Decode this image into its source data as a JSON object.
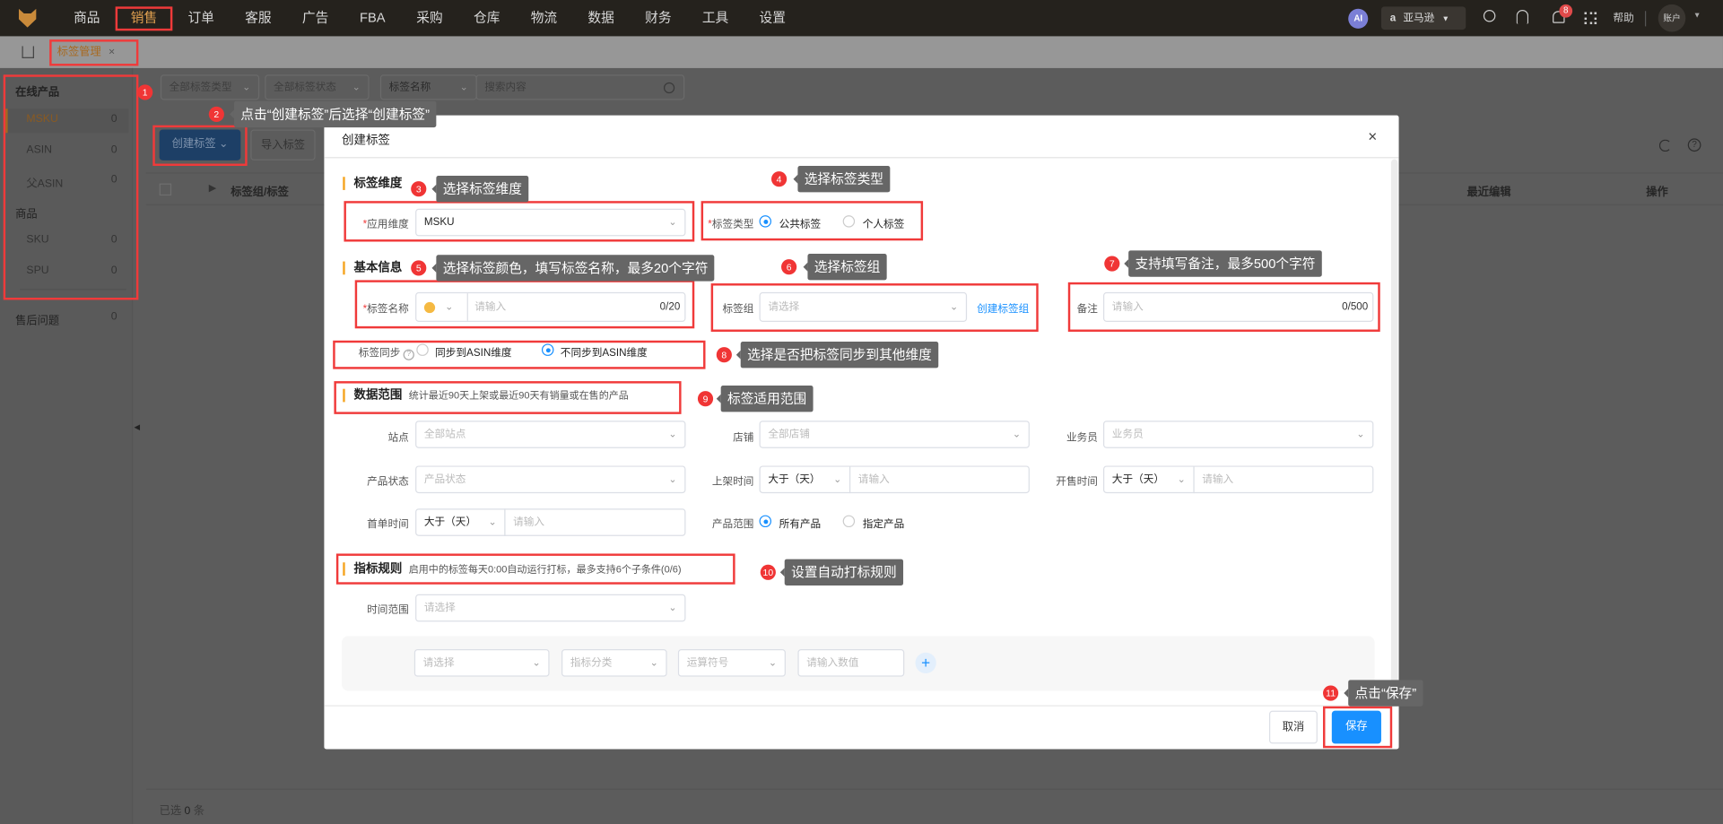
{
  "nav": {
    "items": [
      "商品",
      "销售",
      "订单",
      "客服",
      "广告",
      "FBA",
      "采购",
      "仓库",
      "物流",
      "数据",
      "财务",
      "工具",
      "设置"
    ],
    "active_index": 1,
    "ai_label": "AI",
    "platform": "亚马逊",
    "notification_count": "8",
    "help": "帮助",
    "account": "账户"
  },
  "tabs": {
    "active": "标签管理",
    "close": "×"
  },
  "sidebar": {
    "group1": "在线产品",
    "group1_items": [
      {
        "label": "MSKU",
        "count": "0"
      },
      {
        "label": "ASIN",
        "count": "0"
      },
      {
        "label": "父ASIN",
        "count": "0"
      }
    ],
    "group2": "商品",
    "group2_items": [
      {
        "label": "SKU",
        "count": "0"
      },
      {
        "label": "SPU",
        "count": "0"
      }
    ],
    "after_sales": {
      "label": "售后问题",
      "count": "0"
    }
  },
  "filters": {
    "type": "全部标签类型",
    "status": "全部标签状态",
    "field": "标签名称",
    "search_placeholder": "搜索内容"
  },
  "toolbar": {
    "create": "创建标签",
    "import": "导入标签"
  },
  "table": {
    "col_group": "标签组/标签",
    "col_recent": "最近编辑",
    "col_actions": "操作"
  },
  "footer": {
    "selected_prefix": "已选",
    "selected_count": "0",
    "selected_suffix": "条"
  },
  "modal": {
    "title": "创建标签",
    "close": "×",
    "sec_dimension": "标签维度",
    "apply_dim_label": "应用维度",
    "apply_dim_value": "MSKU",
    "tag_type_label": "标签类型",
    "tag_type_options": [
      "公共标签",
      "个人标签"
    ],
    "sec_basic": "基本信息",
    "tag_name_label": "标签名称",
    "tag_name_placeholder": "请输入",
    "tag_name_counter": "0/20",
    "tag_color": "#f5b942",
    "tag_group_label": "标签组",
    "tag_group_placeholder": "请选择",
    "create_group_link": "创建标签组",
    "remark_label": "备注",
    "remark_placeholder": "请输入",
    "remark_counter": "0/500",
    "sync_label": "标签同步",
    "sync_options": [
      "同步到ASIN维度",
      "不同步到ASIN维度"
    ],
    "sec_scope": "数据范围",
    "sec_scope_desc": "统计最近90天上架或最近90天有销量或在售的产品",
    "site_label": "站点",
    "site_placeholder": "全部站点",
    "shop_label": "店铺",
    "shop_placeholder": "全部店铺",
    "staff_label": "业务员",
    "staff_placeholder": "业务员",
    "status_label": "产品状态",
    "status_placeholder": "产品状态",
    "listed_label": "上架时间",
    "compare": "大于（天）",
    "input_placeholder": "请输入",
    "sale_label": "开售时间",
    "first_order_label": "首单时间",
    "range_label": "产品范围",
    "range_options": [
      "所有产品",
      "指定产品"
    ],
    "sec_rules": "指标规则",
    "sec_rules_desc": "启用中的标签每天0:00自动运行打标，最多支持6个子条件(0/6)",
    "time_range_label": "时间范围",
    "time_range_placeholder": "请选择",
    "cond_select": "请选择",
    "cond_category": "指标分类",
    "cond_operator": "运算符号",
    "cond_value": "请输入数值",
    "add": "+",
    "cancel": "取消",
    "save": "保存"
  },
  "steps": [
    {
      "num": "1"
    },
    {
      "num": "2",
      "text": "点击“创建标签”后选择“创建标签”"
    },
    {
      "num": "3",
      "text": "选择标签维度"
    },
    {
      "num": "4",
      "text": "选择标签类型"
    },
    {
      "num": "5",
      "text": "选择标签颜色，填写标签名称，最多20个字符"
    },
    {
      "num": "6",
      "text": "选择标签组"
    },
    {
      "num": "7",
      "text": "支持填写备注，最多500个字符"
    },
    {
      "num": "8",
      "text": "选择是否把标签同步到其他维度"
    },
    {
      "num": "9",
      "text": "标签适用范围"
    },
    {
      "num": "10",
      "text": "设置自动打标规则"
    },
    {
      "num": "11",
      "text": "点击“保存”"
    }
  ]
}
